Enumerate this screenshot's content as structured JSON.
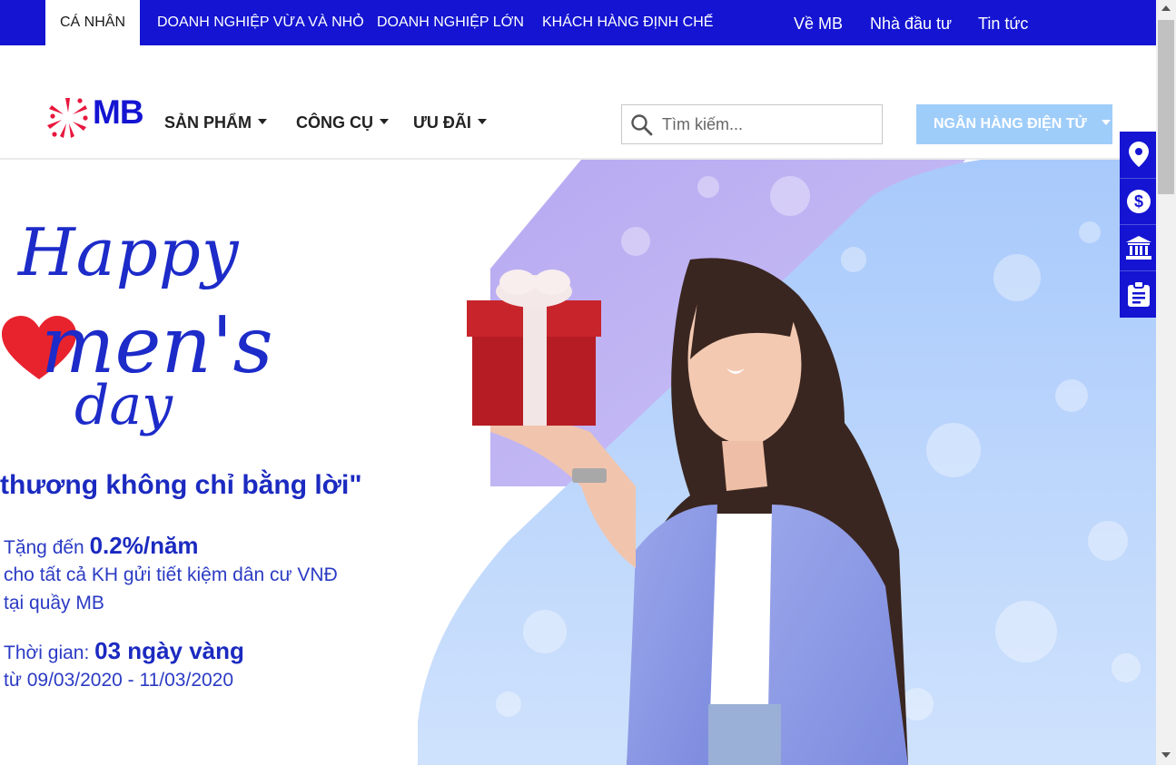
{
  "segments": [
    "CÁ NHÂN",
    "DOANH NGHIỆP VỪA VÀ NHỎ",
    "DOANH NGHIỆP LỚN",
    "KHÁCH HÀNG ĐỊNH CHẾ"
  ],
  "top_links": [
    "Về MB",
    "Nhà đầu tư",
    "Tin tức"
  ],
  "brand": {
    "logo_text": "MB",
    "primary_color": "#1414d2",
    "accent_color": "#e8173d"
  },
  "nav": {
    "products": "SẢN PHẨM",
    "tools": "CÔNG CỤ",
    "offers": "ƯU ĐÃI"
  },
  "search": {
    "placeholder": "Tìm kiếm..."
  },
  "ebank": {
    "label": "NGÂN HÀNG ĐIỆN TỬ"
  },
  "hero": {
    "title_line1": "Happy",
    "title_line2": "men's",
    "title_line3": "day",
    "quote": "thương không chỉ bằng lời\"",
    "line1_prefix": "Tặng đến ",
    "line1_highlight": "0.2%/năm",
    "line2": "cho tất cả KH gửi tiết kiệm dân cư VNĐ",
    "line3": "tại quầy MB",
    "line4_prefix": "Thời gian: ",
    "line4_highlight": "03 ngày vàng",
    "line5": "từ 09/03/2020 - 11/03/2020"
  },
  "side_tools": [
    "location-icon",
    "dollar-icon",
    "bank-icon",
    "clipboard-icon"
  ]
}
